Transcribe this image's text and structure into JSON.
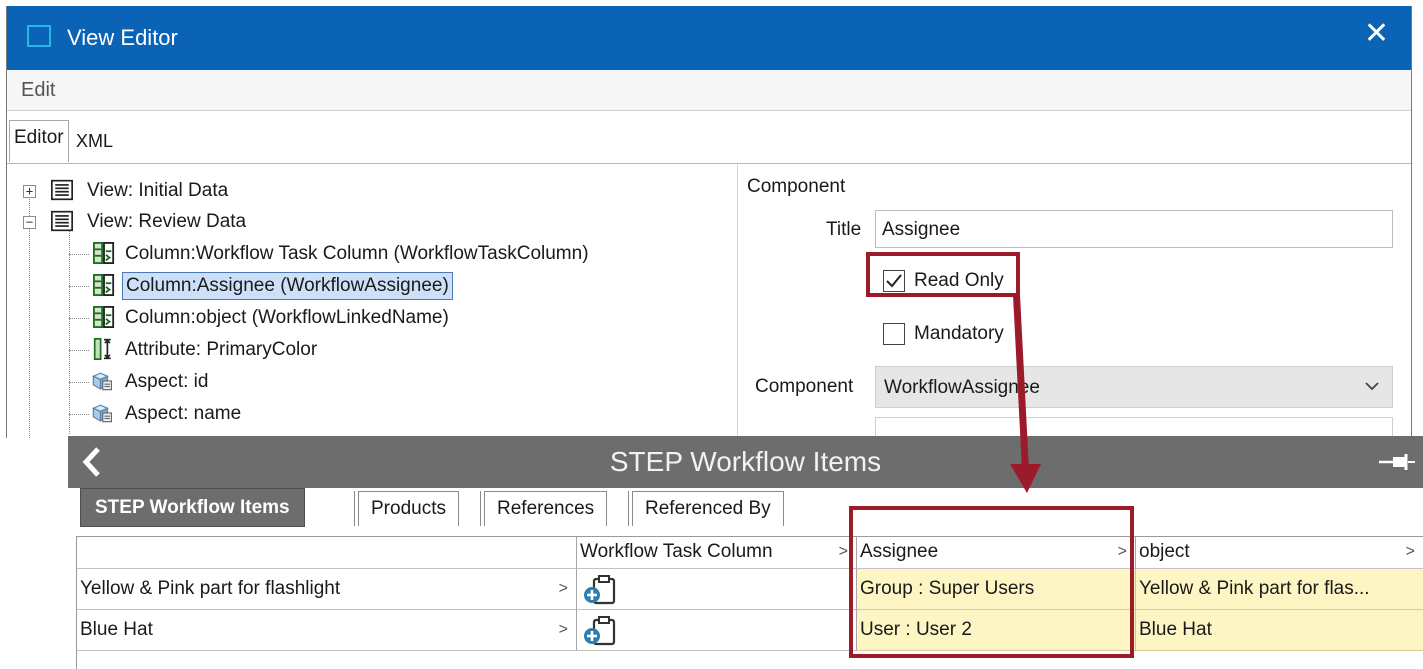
{
  "window": {
    "title": "View Editor",
    "menu": [
      "Edit"
    ],
    "tabs": {
      "editor": "Editor",
      "xml": "XML"
    }
  },
  "tree": {
    "nodes": [
      {
        "label": "View: Initial Data",
        "icon": "view-list-icon",
        "expander": "+"
      },
      {
        "label": "View: Review Data",
        "icon": "view-list-icon",
        "expander": "−"
      },
      {
        "label": "Column:Workflow Task Column (WorkflowTaskColumn)",
        "icon": "column-icon"
      },
      {
        "label": "Column:Assignee (WorkflowAssignee)",
        "icon": "column-icon",
        "selected": true
      },
      {
        "label": "Column:object (WorkflowLinkedName)",
        "icon": "column-icon"
      },
      {
        "label": "Attribute: PrimaryColor",
        "icon": "attribute-icon"
      },
      {
        "label": "Aspect: id",
        "icon": "aspect-icon"
      },
      {
        "label": "Aspect: name",
        "icon": "aspect-icon"
      }
    ]
  },
  "properties": {
    "header": "Component",
    "title_label": "Title",
    "title_value": "Assignee",
    "read_only_label": "Read Only",
    "read_only_checked": true,
    "mandatory_label": "Mandatory",
    "mandatory_checked": false,
    "component_label": "Component",
    "component_value": "WorkflowAssignee"
  },
  "panel": {
    "title": "STEP Workflow Items",
    "tabs": [
      "STEP Workflow Items",
      "Products",
      "References",
      "Referenced By"
    ],
    "columns": [
      "",
      "Workflow Task Column",
      "Assignee",
      "object"
    ],
    "rows": [
      {
        "name": "Yellow & Pink part for flashlight",
        "task_icon": "workflow-task-icon",
        "assignee": "Group : Super Users",
        "object": "Yellow & Pink part for flas..."
      },
      {
        "name": "Blue Hat",
        "task_icon": "workflow-task-icon",
        "assignee": "User : User 2",
        "object": "Blue Hat"
      }
    ]
  },
  "colors": {
    "titlebar": "#0a63b5",
    "panel_header": "#6d6d6d",
    "highlight": "#9b1b2b",
    "readonly_cell": "#fdf5c3",
    "selection": "#cde0f7"
  }
}
